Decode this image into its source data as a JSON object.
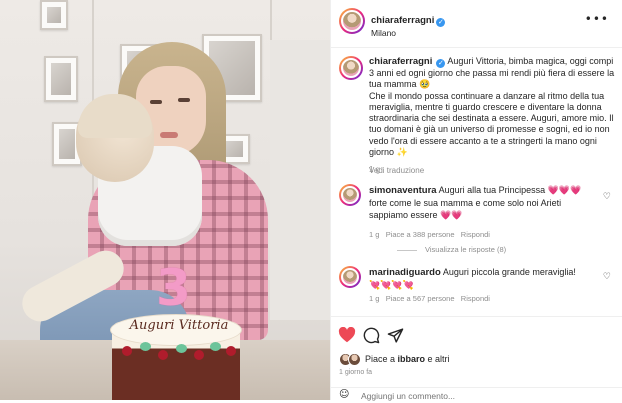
{
  "post": {
    "username": "chiaraferragni",
    "location": "Milano",
    "caption_paragraphs": [
      "Auguri Vittoria, bimba magica, oggi compi 3 anni ed ogni giorno che passa mi rendi più fiera di essere la tua mamma 🥹",
      "Che il mondo possa continuare a danzare al ritmo della tua meraviglia, mentre ti guardo crescere e diventare la donna straordinaria che sei destinata a essere. Auguri, amore mio. Il tuo domani è già un universo di promesse e sogni, ed io non vedo l'ora di essere accanto a te a stringerti la mano ogni giorno ✨"
    ],
    "caption_age": "1 g",
    "see_translation": "Vedi traduzione",
    "cake_text": "Auguri Vittoria",
    "candle_number": "3"
  },
  "comments": [
    {
      "username": "simonaventura",
      "text": "Auguri alla tua Principessa 💗💗💗 forte come le sua mamma e come solo noi Arieti sappiamo essere 💗💗",
      "age": "1 g",
      "likes": "Piace a 388 persone",
      "reply": "Rispondi",
      "view_replies": "Visualizza le risposte (8)"
    },
    {
      "username": "marinadiguardo",
      "text": "Auguri piccola grande meraviglia! 💘💘💘💘",
      "age": "1 g",
      "likes": "Piace a 567 persone",
      "reply": "Rispondi"
    }
  ],
  "actions": {
    "liked_by_prefix": "Piace a ",
    "liked_by_user": "ibbaro",
    "liked_by_suffix": " e altri",
    "time_ago": "1 giorno fa",
    "comment_placeholder": "Aggiungi un commento..."
  },
  "colors": {
    "like_red": "#ed4956",
    "verified_blue": "#3897f0",
    "muted_text": "#8e8e8e"
  },
  "icons": [
    "heart-icon",
    "comment-icon",
    "share-icon",
    "more-options-icon",
    "verified-icon",
    "emoji-icon"
  ]
}
